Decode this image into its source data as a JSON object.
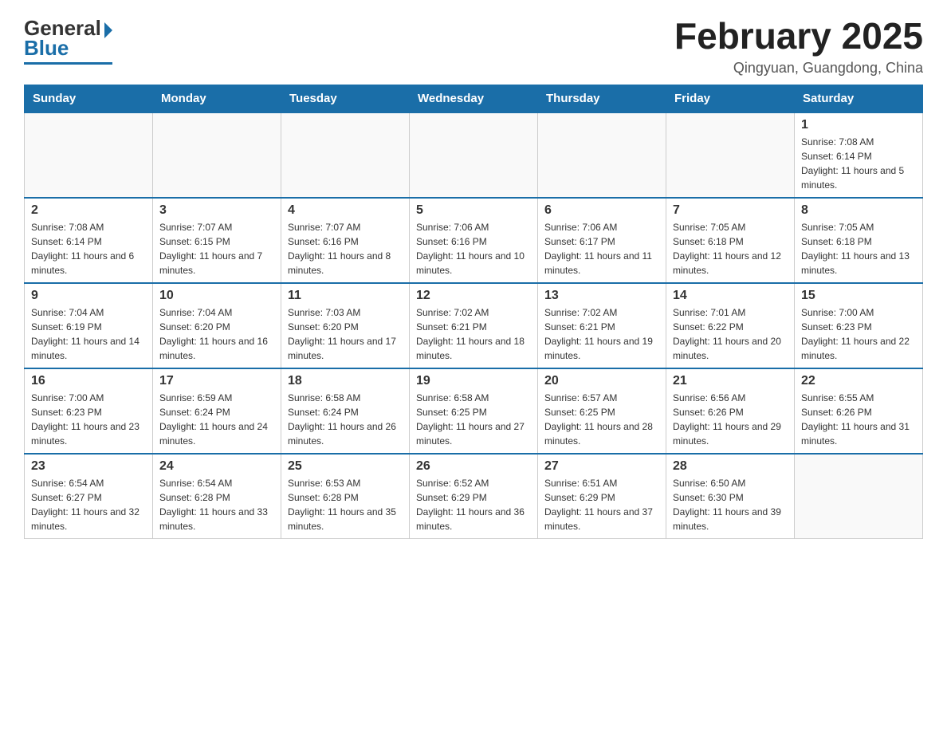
{
  "header": {
    "logo": {
      "general": "General",
      "blue": "Blue"
    },
    "title": "February 2025",
    "location": "Qingyuan, Guangdong, China"
  },
  "weekdays": [
    "Sunday",
    "Monday",
    "Tuesday",
    "Wednesday",
    "Thursday",
    "Friday",
    "Saturday"
  ],
  "weeks": [
    [
      {
        "day": "",
        "info": ""
      },
      {
        "day": "",
        "info": ""
      },
      {
        "day": "",
        "info": ""
      },
      {
        "day": "",
        "info": ""
      },
      {
        "day": "",
        "info": ""
      },
      {
        "day": "",
        "info": ""
      },
      {
        "day": "1",
        "info": "Sunrise: 7:08 AM\nSunset: 6:14 PM\nDaylight: 11 hours and 5 minutes."
      }
    ],
    [
      {
        "day": "2",
        "info": "Sunrise: 7:08 AM\nSunset: 6:14 PM\nDaylight: 11 hours and 6 minutes."
      },
      {
        "day": "3",
        "info": "Sunrise: 7:07 AM\nSunset: 6:15 PM\nDaylight: 11 hours and 7 minutes."
      },
      {
        "day": "4",
        "info": "Sunrise: 7:07 AM\nSunset: 6:16 PM\nDaylight: 11 hours and 8 minutes."
      },
      {
        "day": "5",
        "info": "Sunrise: 7:06 AM\nSunset: 6:16 PM\nDaylight: 11 hours and 10 minutes."
      },
      {
        "day": "6",
        "info": "Sunrise: 7:06 AM\nSunset: 6:17 PM\nDaylight: 11 hours and 11 minutes."
      },
      {
        "day": "7",
        "info": "Sunrise: 7:05 AM\nSunset: 6:18 PM\nDaylight: 11 hours and 12 minutes."
      },
      {
        "day": "8",
        "info": "Sunrise: 7:05 AM\nSunset: 6:18 PM\nDaylight: 11 hours and 13 minutes."
      }
    ],
    [
      {
        "day": "9",
        "info": "Sunrise: 7:04 AM\nSunset: 6:19 PM\nDaylight: 11 hours and 14 minutes."
      },
      {
        "day": "10",
        "info": "Sunrise: 7:04 AM\nSunset: 6:20 PM\nDaylight: 11 hours and 16 minutes."
      },
      {
        "day": "11",
        "info": "Sunrise: 7:03 AM\nSunset: 6:20 PM\nDaylight: 11 hours and 17 minutes."
      },
      {
        "day": "12",
        "info": "Sunrise: 7:02 AM\nSunset: 6:21 PM\nDaylight: 11 hours and 18 minutes."
      },
      {
        "day": "13",
        "info": "Sunrise: 7:02 AM\nSunset: 6:21 PM\nDaylight: 11 hours and 19 minutes."
      },
      {
        "day": "14",
        "info": "Sunrise: 7:01 AM\nSunset: 6:22 PM\nDaylight: 11 hours and 20 minutes."
      },
      {
        "day": "15",
        "info": "Sunrise: 7:00 AM\nSunset: 6:23 PM\nDaylight: 11 hours and 22 minutes."
      }
    ],
    [
      {
        "day": "16",
        "info": "Sunrise: 7:00 AM\nSunset: 6:23 PM\nDaylight: 11 hours and 23 minutes."
      },
      {
        "day": "17",
        "info": "Sunrise: 6:59 AM\nSunset: 6:24 PM\nDaylight: 11 hours and 24 minutes."
      },
      {
        "day": "18",
        "info": "Sunrise: 6:58 AM\nSunset: 6:24 PM\nDaylight: 11 hours and 26 minutes."
      },
      {
        "day": "19",
        "info": "Sunrise: 6:58 AM\nSunset: 6:25 PM\nDaylight: 11 hours and 27 minutes."
      },
      {
        "day": "20",
        "info": "Sunrise: 6:57 AM\nSunset: 6:25 PM\nDaylight: 11 hours and 28 minutes."
      },
      {
        "day": "21",
        "info": "Sunrise: 6:56 AM\nSunset: 6:26 PM\nDaylight: 11 hours and 29 minutes."
      },
      {
        "day": "22",
        "info": "Sunrise: 6:55 AM\nSunset: 6:26 PM\nDaylight: 11 hours and 31 minutes."
      }
    ],
    [
      {
        "day": "23",
        "info": "Sunrise: 6:54 AM\nSunset: 6:27 PM\nDaylight: 11 hours and 32 minutes."
      },
      {
        "day": "24",
        "info": "Sunrise: 6:54 AM\nSunset: 6:28 PM\nDaylight: 11 hours and 33 minutes."
      },
      {
        "day": "25",
        "info": "Sunrise: 6:53 AM\nSunset: 6:28 PM\nDaylight: 11 hours and 35 minutes."
      },
      {
        "day": "26",
        "info": "Sunrise: 6:52 AM\nSunset: 6:29 PM\nDaylight: 11 hours and 36 minutes."
      },
      {
        "day": "27",
        "info": "Sunrise: 6:51 AM\nSunset: 6:29 PM\nDaylight: 11 hours and 37 minutes."
      },
      {
        "day": "28",
        "info": "Sunrise: 6:50 AM\nSunset: 6:30 PM\nDaylight: 11 hours and 39 minutes."
      },
      {
        "day": "",
        "info": ""
      }
    ]
  ]
}
